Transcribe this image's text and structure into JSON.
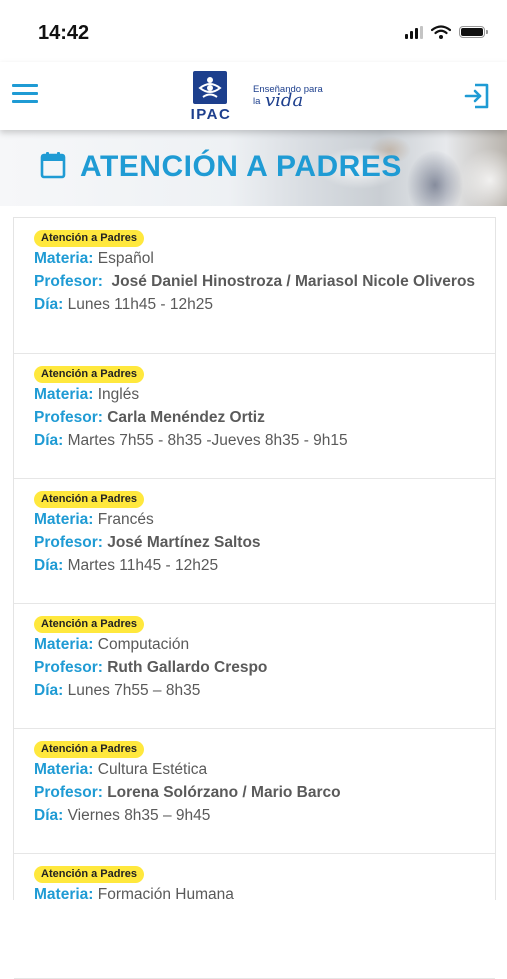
{
  "status_bar": {
    "time": "14:42",
    "signal_icon": "cellular-signal-icon",
    "wifi_icon": "wifi-icon",
    "battery_icon": "battery-icon"
  },
  "header": {
    "menu_icon": "hamburger-menu-icon",
    "logo": {
      "name": "IPAC",
      "slogan_line1": "Enseñando para",
      "slogan_line2": "la",
      "slogan_script": "vida"
    },
    "logout_icon": "logout-icon"
  },
  "banner": {
    "title": "ATENCIÓN A PADRES",
    "icon": "calendar-icon"
  },
  "labels": {
    "materia": "Materia:",
    "profesor": "Profesor:",
    "dia": "Día:"
  },
  "colors": {
    "accent": "#1f9bd4",
    "badge": "#ffe83d",
    "brand": "#1d3f8d"
  },
  "items": [
    {
      "badge": "Atención a Padres",
      "materia": "Español",
      "profesor": "José Daniel Hinostroza / Mariasol Nicole Oliveros",
      "dia": "Lunes 11h45 - 12h25"
    },
    {
      "badge": "Atención a Padres",
      "materia": "Inglés",
      "profesor": "Carla Menéndez Ortiz",
      "dia": "Martes 7h55 - 8h35 -Jueves 8h35 -  9h15"
    },
    {
      "badge": "Atención a Padres",
      "materia": "Francés",
      "profesor": "José Martínez Saltos",
      "dia": "Martes 11h45 - 12h25"
    },
    {
      "badge": "Atención a Padres",
      "materia": "Computación",
      "profesor": "Ruth Gallardo Crespo",
      "dia": "Lunes 7h55 – 8h35"
    },
    {
      "badge": "Atención a Padres",
      "materia": "Cultura Estética",
      "profesor": "Lorena Solórzano / Mario Barco",
      "dia": "Viernes 8h35 – 9h45"
    },
    {
      "badge": "Atención a Padres",
      "materia": "Formación Humana",
      "profesor": "",
      "dia": ""
    }
  ]
}
